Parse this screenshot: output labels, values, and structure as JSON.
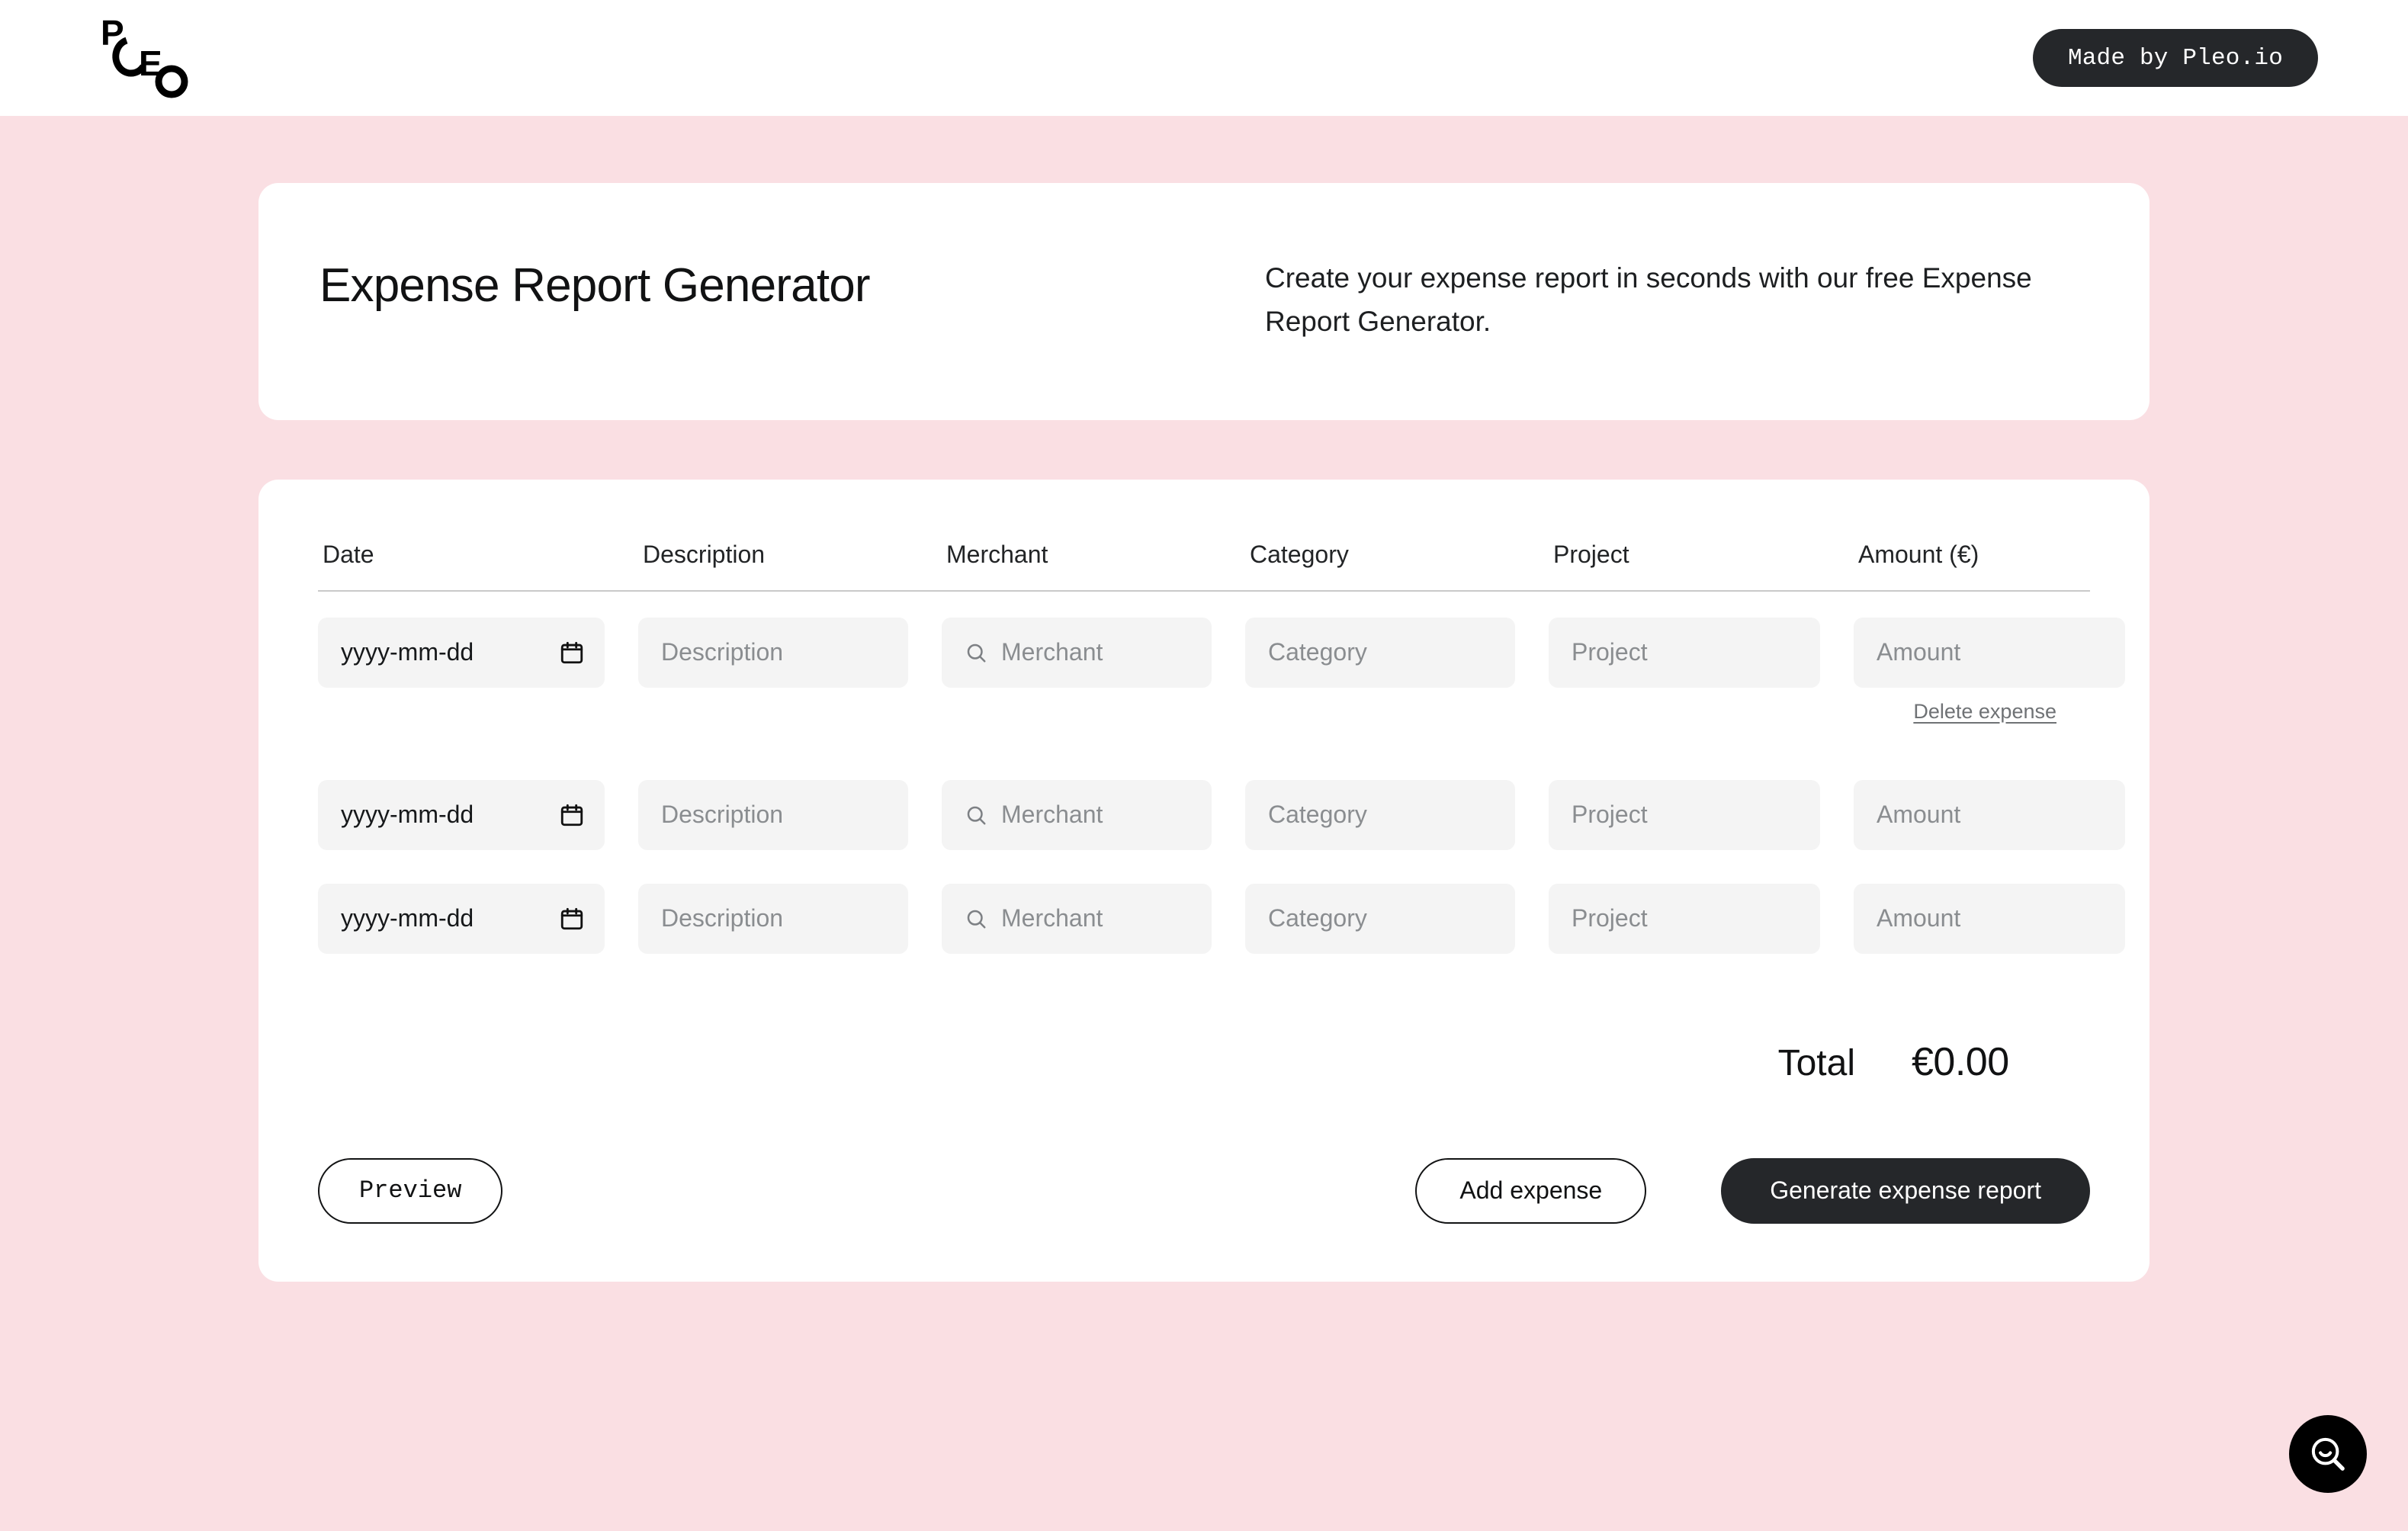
{
  "topbar": {
    "logo_alt": "Pleo",
    "cta_label": "Made by Pleo.io"
  },
  "hero": {
    "title": "Expense Report Generator",
    "description": "Create your expense report in seconds with our free Expense Report Generator."
  },
  "table": {
    "headers": {
      "date": "Date",
      "description": "Description",
      "merchant": "Merchant",
      "category": "Category",
      "project": "Project",
      "amount": "Amount (€)"
    },
    "placeholders": {
      "date": "yyyy-mm-dd",
      "description": "Description",
      "merchant": "Merchant",
      "category": "Category",
      "project": "Project",
      "amount": "Amount"
    },
    "values": {
      "date": "",
      "description": "",
      "merchant": "",
      "category": "",
      "project": "",
      "amount": ""
    },
    "row_actions": {
      "delete_label": "Delete expense"
    },
    "total": {
      "label": "Total",
      "value": "€0.00"
    }
  },
  "actions": {
    "preview_label": "Preview",
    "add_expense_label": "Add expense",
    "generate_label": "Generate expense report"
  },
  "support": {
    "fab_icon": "search-smile-icon"
  },
  "colors": {
    "page_background": "#fadfe3",
    "card_background": "#ffffff",
    "input_background": "#f4f4f4",
    "dark_button": "#25272a",
    "placeholder_text": "#8a8d90",
    "divider": "#c9c9c9"
  }
}
